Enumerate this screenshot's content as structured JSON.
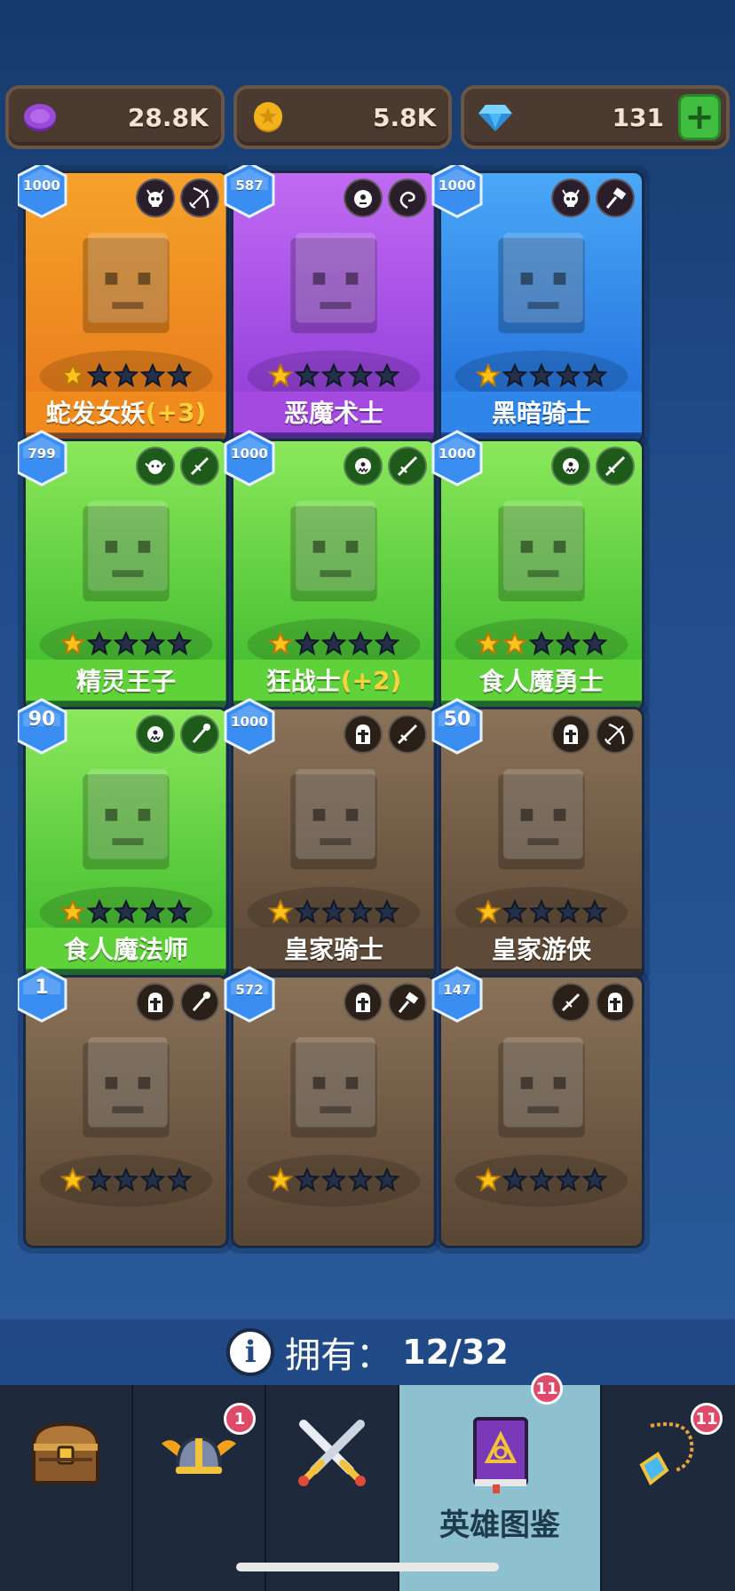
{
  "currency": {
    "purple": {
      "value": "28.8K",
      "icon": "purple-coin-icon",
      "color": "#9a4ad8"
    },
    "gold": {
      "value": "5.8K",
      "icon": "gold-coin-icon",
      "color": "#f2b21c"
    },
    "gem": {
      "value": "131",
      "icon": "diamond-icon",
      "color": "#4ab8f2",
      "add_label": "+"
    }
  },
  "heroes": [
    {
      "badge": "1000",
      "name": "蛇发女妖",
      "bonus": "(+3)",
      "stars": 1,
      "bg": "orange",
      "classes": [
        "horned-skull-icon",
        "bow-icon"
      ]
    },
    {
      "badge": "587",
      "name": "恶魔术士",
      "bonus": "",
      "stars": 1,
      "bg": "purple",
      "classes": [
        "demon-face-icon",
        "swirl-icon"
      ]
    },
    {
      "badge": "1000",
      "name": "黑暗骑士",
      "bonus": "",
      "stars": 1,
      "bg": "blue",
      "classes": [
        "horned-skull-icon",
        "hammer-icon"
      ]
    },
    {
      "badge": "799",
      "name": "精灵王子",
      "bonus": "",
      "stars": 1,
      "bg": "green",
      "classes": [
        "elf-face-icon",
        "dagger-icon"
      ]
    },
    {
      "badge": "1000",
      "name": "狂战士",
      "bonus": "(+2)",
      "stars": 1,
      "bg": "green",
      "classes": [
        "orc-face-icon",
        "sword-icon"
      ]
    },
    {
      "badge": "1000",
      "name": "食人魔勇士",
      "bonus": "",
      "stars": 2,
      "bg": "green",
      "classes": [
        "orc-face-icon",
        "sword-icon"
      ]
    },
    {
      "badge": "90",
      "name": "食人魔法师",
      "bonus": "",
      "stars": 1,
      "bg": "green",
      "classes": [
        "orc-face-icon",
        "staff-icon"
      ]
    },
    {
      "badge": "1000",
      "name": "皇家骑士",
      "bonus": "",
      "stars": 1,
      "bg": "brown",
      "classes": [
        "knight-helmet-icon",
        "sword-icon"
      ]
    },
    {
      "badge": "50",
      "name": "皇家游侠",
      "bonus": "",
      "stars": 1,
      "bg": "brown",
      "classes": [
        "knight-helmet-icon",
        "bow-icon"
      ]
    },
    {
      "badge": "1",
      "name": "",
      "bonus": "",
      "stars": 1,
      "bg": "brown",
      "classes": [
        "knight-helmet-icon",
        "staff-icon"
      ]
    },
    {
      "badge": "572",
      "name": "",
      "bonus": "",
      "stars": 1,
      "bg": "brown",
      "classes": [
        "knight-helmet-icon",
        "hammer-icon"
      ]
    },
    {
      "badge": "147",
      "name": "",
      "bonus": "",
      "stars": 1,
      "bg": "brown",
      "classes": [
        "dagger-icon",
        "knight-helmet-icon"
      ]
    }
  ],
  "owned": {
    "label": "拥有：",
    "count": "12/32",
    "info_icon": "info-icon"
  },
  "nav": {
    "items": [
      {
        "icon": "treasure-chest-icon",
        "label": "",
        "badge": ""
      },
      {
        "icon": "winged-helmet-icon",
        "label": "",
        "badge": "1"
      },
      {
        "icon": "crossed-swords-icon",
        "label": "",
        "badge": ""
      },
      {
        "icon": "spellbook-icon",
        "label": "英雄图鉴",
        "badge": "11",
        "active": true
      },
      {
        "icon": "amulet-icon",
        "label": "",
        "badge": "11"
      }
    ]
  },
  "colors": {
    "background": "#1f4a86",
    "orange": "#f08a1e",
    "purple": "#a44ae0",
    "blue": "#2f86e8",
    "green": "#5fd23a",
    "brown": "#5e4a38",
    "bonus": "#ffd23a",
    "nav_active": "#8ec1cf",
    "notification": "#e04a6a"
  }
}
